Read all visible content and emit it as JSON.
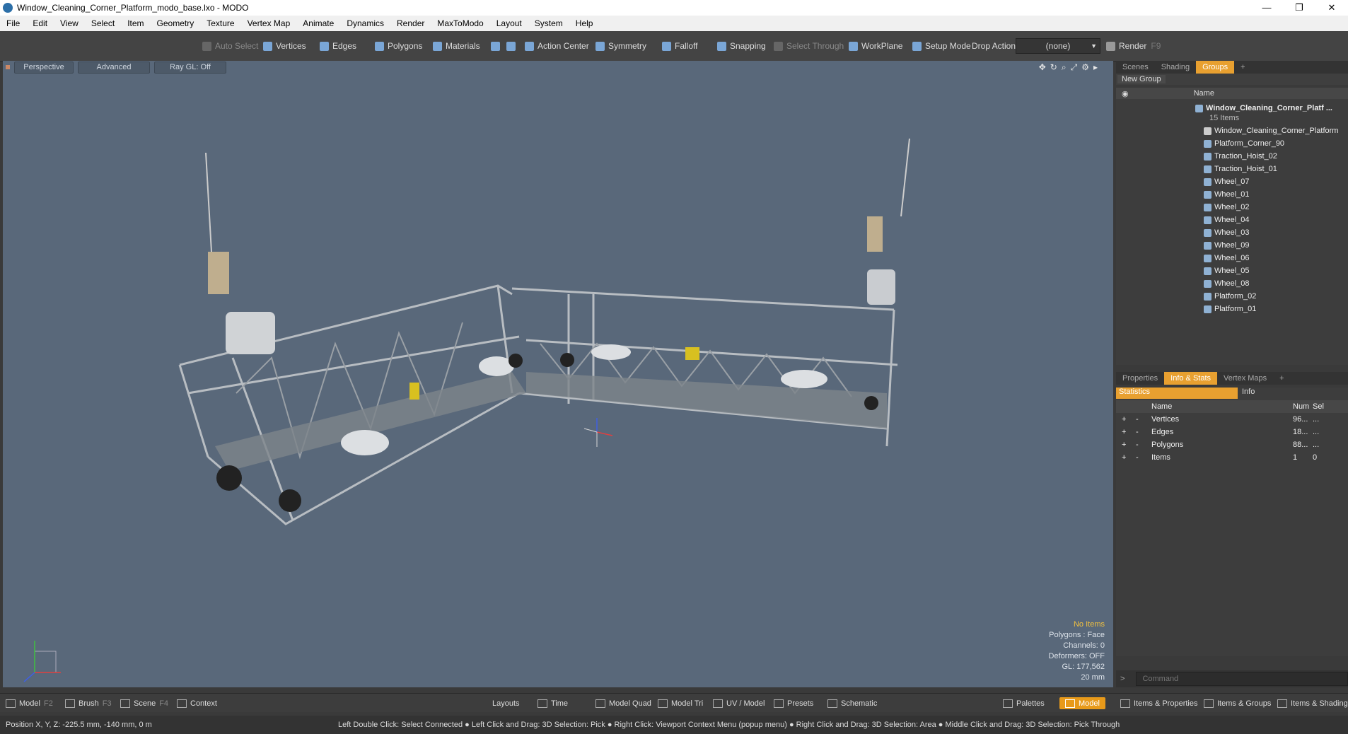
{
  "window": {
    "title": "Window_Cleaning_Corner_Platform_modo_base.lxo - MODO"
  },
  "menu": [
    "File",
    "Edit",
    "View",
    "Select",
    "Item",
    "Geometry",
    "Texture",
    "Vertex Map",
    "Animate",
    "Dynamics",
    "Render",
    "MaxToModo",
    "Layout",
    "System",
    "Help"
  ],
  "toolbar": {
    "auto_select": "Auto Select",
    "vertices": "Vertices",
    "edges": "Edges",
    "polygons": "Polygons",
    "materials": "Materials",
    "action_center": "Action Center",
    "symmetry": "Symmetry",
    "falloff": "Falloff",
    "snapping": "Snapping",
    "select_through": "Select Through",
    "workplane": "WorkPlane",
    "setup_mode": "Setup Mode",
    "drop_action": "Drop Action",
    "drop_action_value": "(none)",
    "render": "Render",
    "render_key": "F9"
  },
  "viewport": {
    "view": "Perspective",
    "mode": "Advanced",
    "raygl": "Ray GL: Off",
    "info": {
      "selection": "No Items",
      "polygons": "Polygons : Face",
      "channels": "Channels: 0",
      "deformers": "Deformers: OFF",
      "gl": "GL: 177,562",
      "scale": "20 mm"
    }
  },
  "right_panel": {
    "top_tabs": [
      "Scenes",
      "Shading",
      "Groups"
    ],
    "active_top_tab": "Groups",
    "new_group": "New Group",
    "name_col": "Name",
    "group_name": "Window_Cleaning_Corner_Platf ...",
    "group_count": "15 Items",
    "items": [
      "Window_Cleaning_Corner_Platform",
      "Platform_Corner_90",
      "Traction_Hoist_02",
      "Traction_Hoist_01",
      "Wheel_07",
      "Wheel_01",
      "Wheel_02",
      "Wheel_04",
      "Wheel_03",
      "Wheel_09",
      "Wheel_06",
      "Wheel_05",
      "Wheel_08",
      "Platform_02",
      "Platform_01"
    ],
    "bottom_tabs": [
      "Properties",
      "Info & Stats",
      "Vertex Maps"
    ],
    "active_bottom_tab": "Info & Stats",
    "stats_tabs": [
      "Statistics",
      "Info"
    ],
    "stats_cols": {
      "name": "Name",
      "num": "Num",
      "sel": "Sel"
    },
    "stats_rows": [
      {
        "name": "Vertices",
        "num": "96...",
        "sel": "..."
      },
      {
        "name": "Edges",
        "num": "18...",
        "sel": "..."
      },
      {
        "name": "Polygons",
        "num": "88...",
        "sel": "..."
      },
      {
        "name": "Items",
        "num": "1",
        "sel": "0"
      }
    ],
    "command_placeholder": "Command"
  },
  "bottombar": {
    "model": "Model",
    "model_key": "F2",
    "brush": "Brush",
    "brush_key": "F3",
    "scene": "Scene",
    "scene_key": "F4",
    "context": "Context",
    "layouts": "Layouts",
    "time": "Time",
    "model_quad": "Model Quad",
    "model_tri": "Model Tri",
    "uv_model": "UV / Model",
    "presets": "Presets",
    "schematic": "Schematic",
    "palettes": "Palettes",
    "model_active": "Model",
    "items_properties": "Items & Properties",
    "items_groups": "Items & Groups",
    "items_shading": "Items & Shading"
  },
  "statusbar": {
    "position": "Position X, Y, Z:   -225.5 mm, -140 mm, 0 m",
    "hints": "Left Double Click: Select Connected ● Left Click and Drag: 3D Selection: Pick ● Right Click: Viewport Context Menu (popup menu) ● Right Click and Drag: 3D Selection: Area ● Middle Click and Drag: 3D Selection: Pick Through"
  }
}
